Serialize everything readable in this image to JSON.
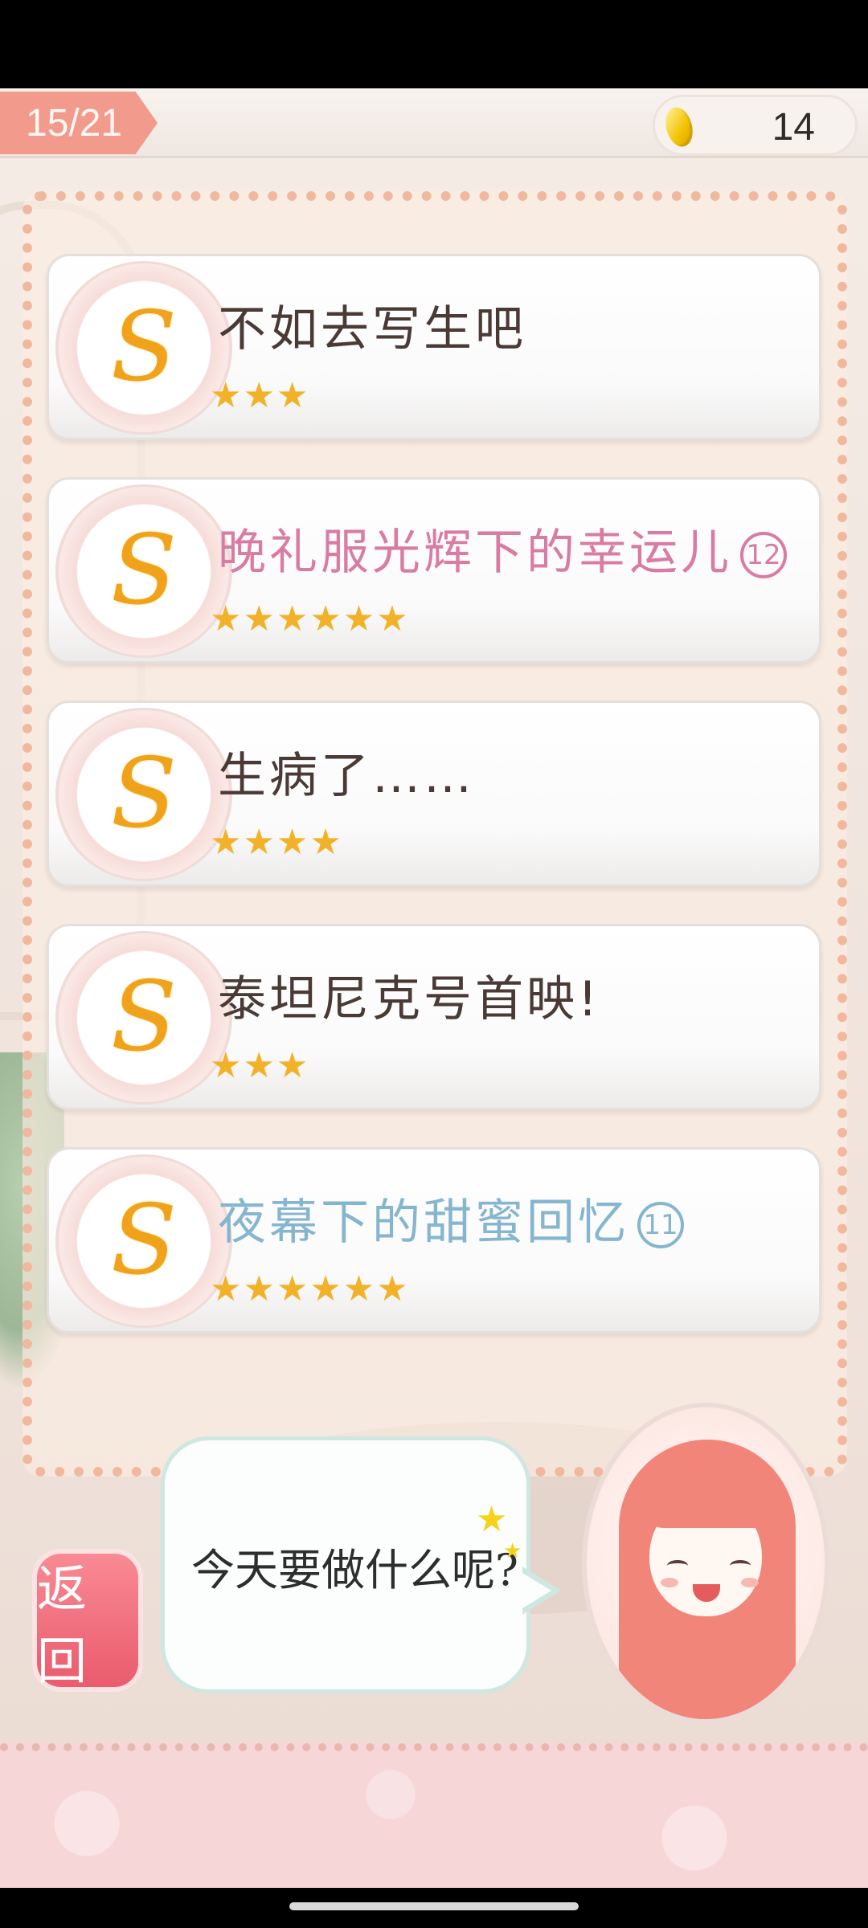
{
  "header": {
    "level_progress": "15/21",
    "coins": "14"
  },
  "quests": [
    {
      "title": "不如去写生吧",
      "number": "",
      "stars": "★★★",
      "color": "dark"
    },
    {
      "title": "晚礼服光辉下的幸运儿",
      "number": "12",
      "stars": "★★★★★★",
      "color": "pink"
    },
    {
      "title": "生病了……",
      "number": "",
      "stars": "★★★★",
      "color": "dark"
    },
    {
      "title": "泰坦尼克号首映!",
      "number": "",
      "stars": "★★★",
      "color": "dark"
    },
    {
      "title": "夜幕下的甜蜜回忆",
      "number": "11",
      "stars": "★★★★★★",
      "color": "blue"
    }
  ],
  "footer": {
    "back_label": "返回",
    "speech": "今天要做什么呢?"
  },
  "colors": {
    "accent_pink": "#f29a8c",
    "back_button": "#ea5b6d",
    "star": "#f1b22a",
    "title_pink": "#d97ca3",
    "title_blue": "#86b6cf"
  },
  "icons": {
    "quest_icon": "swirl-s-icon",
    "coin": "coin-icon"
  }
}
